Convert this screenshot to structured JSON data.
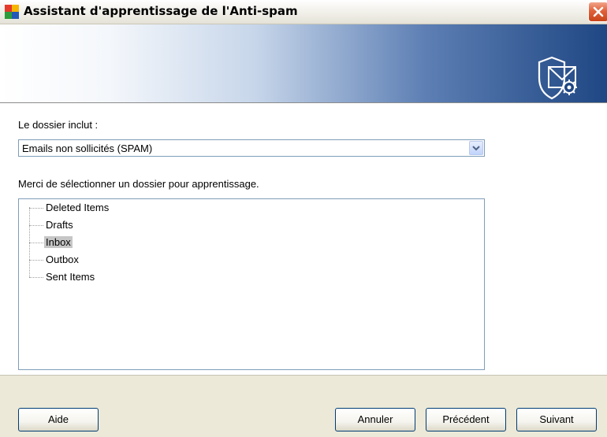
{
  "window": {
    "title": "Assistant d'apprentissage de l'Anti-spam",
    "app_icon": "avg-colored-squares-icon",
    "close_icon": "close-icon"
  },
  "banner": {
    "icon": "shield-envelope-gear-icon"
  },
  "folder_type": {
    "label": "Le dossier inclut :",
    "selected_value": "Emails non sollicités (SPAM)",
    "dropdown_icon": "chevron-down-icon"
  },
  "folder_tree": {
    "instruction": "Merci de sélectionner un dossier pour apprentissage.",
    "items": [
      {
        "label": "Deleted Items",
        "selected": false
      },
      {
        "label": "Drafts",
        "selected": false
      },
      {
        "label": "Inbox",
        "selected": true
      },
      {
        "label": "Outbox",
        "selected": false
      },
      {
        "label": "Sent Items",
        "selected": false
      }
    ]
  },
  "footer": {
    "help_label": "Aide",
    "cancel_label": "Annuler",
    "previous_label": "Précédent",
    "next_label": "Suivant"
  },
  "colors": {
    "banner_dark": "#1f4783",
    "selection": "#c6c6c6",
    "border": "#7f9db9"
  }
}
